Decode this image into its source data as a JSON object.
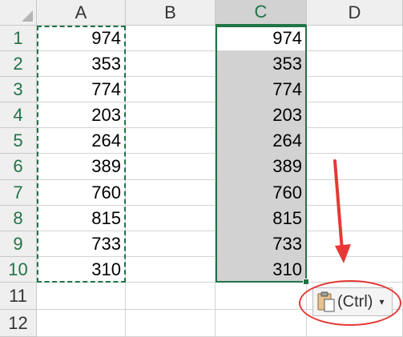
{
  "columns": [
    "A",
    "B",
    "C",
    "D"
  ],
  "rows": [
    "1",
    "2",
    "3",
    "4",
    "5",
    "6",
    "7",
    "8",
    "9",
    "10",
    "11",
    "12"
  ],
  "colA": [
    "974",
    "353",
    "774",
    "203",
    "264",
    "389",
    "760",
    "815",
    "733",
    "310"
  ],
  "colC": [
    "974",
    "353",
    "774",
    "203",
    "264",
    "389",
    "760",
    "815",
    "733",
    "310"
  ],
  "paste_options": {
    "label": "(Ctrl)",
    "icon": "clipboard-paste-icon",
    "caret": "▾"
  },
  "colors": {
    "accent": "#217346",
    "annotation": "#e53935",
    "selection": "#d2d2d2"
  }
}
